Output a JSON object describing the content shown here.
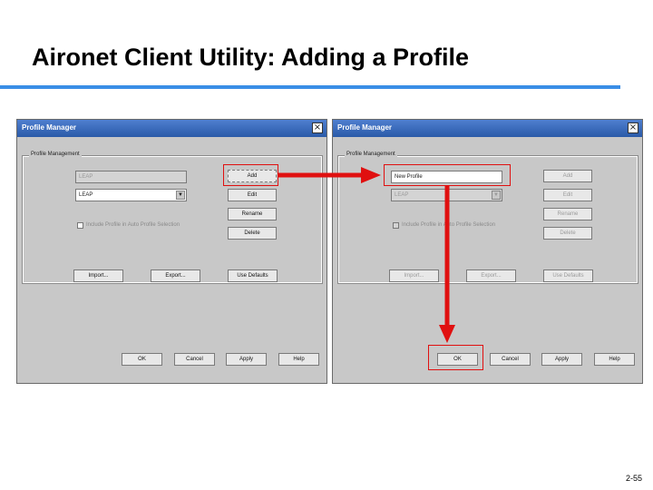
{
  "slide": {
    "title": "Aironet Client Utility: Adding a Profile",
    "page_number": "2-55"
  },
  "windows": [
    {
      "title": "Profile Manager",
      "group_label": "Profile Management",
      "name_field": "LEAP",
      "profile_select": "LEAP",
      "checkbox_label": "Include Profile in Auto Profile Selection",
      "buttons": {
        "add": "Add",
        "edit": "Edit",
        "rename": "Rename",
        "delete": "Delete",
        "import": "Import...",
        "export": "Export...",
        "use_defaults": "Use Defaults",
        "ok": "OK",
        "cancel": "Cancel",
        "apply": "Apply",
        "help": "Help"
      }
    },
    {
      "title": "Profile Manager",
      "group_label": "Profile Management",
      "name_field": "New Profile",
      "profile_select": "LEAP",
      "checkbox_label": "Include Profile in Auto Profile Selection",
      "buttons": {
        "add": "Add",
        "edit": "Edit",
        "rename": "Rename",
        "delete": "Delete",
        "import": "Import...",
        "export": "Export...",
        "use_defaults": "Use Defaults",
        "ok": "OK",
        "cancel": "Cancel",
        "apply": "Apply",
        "help": "Help"
      }
    }
  ],
  "colors": {
    "accent_rule": "#3a8ee6",
    "highlight": "#e01010"
  }
}
